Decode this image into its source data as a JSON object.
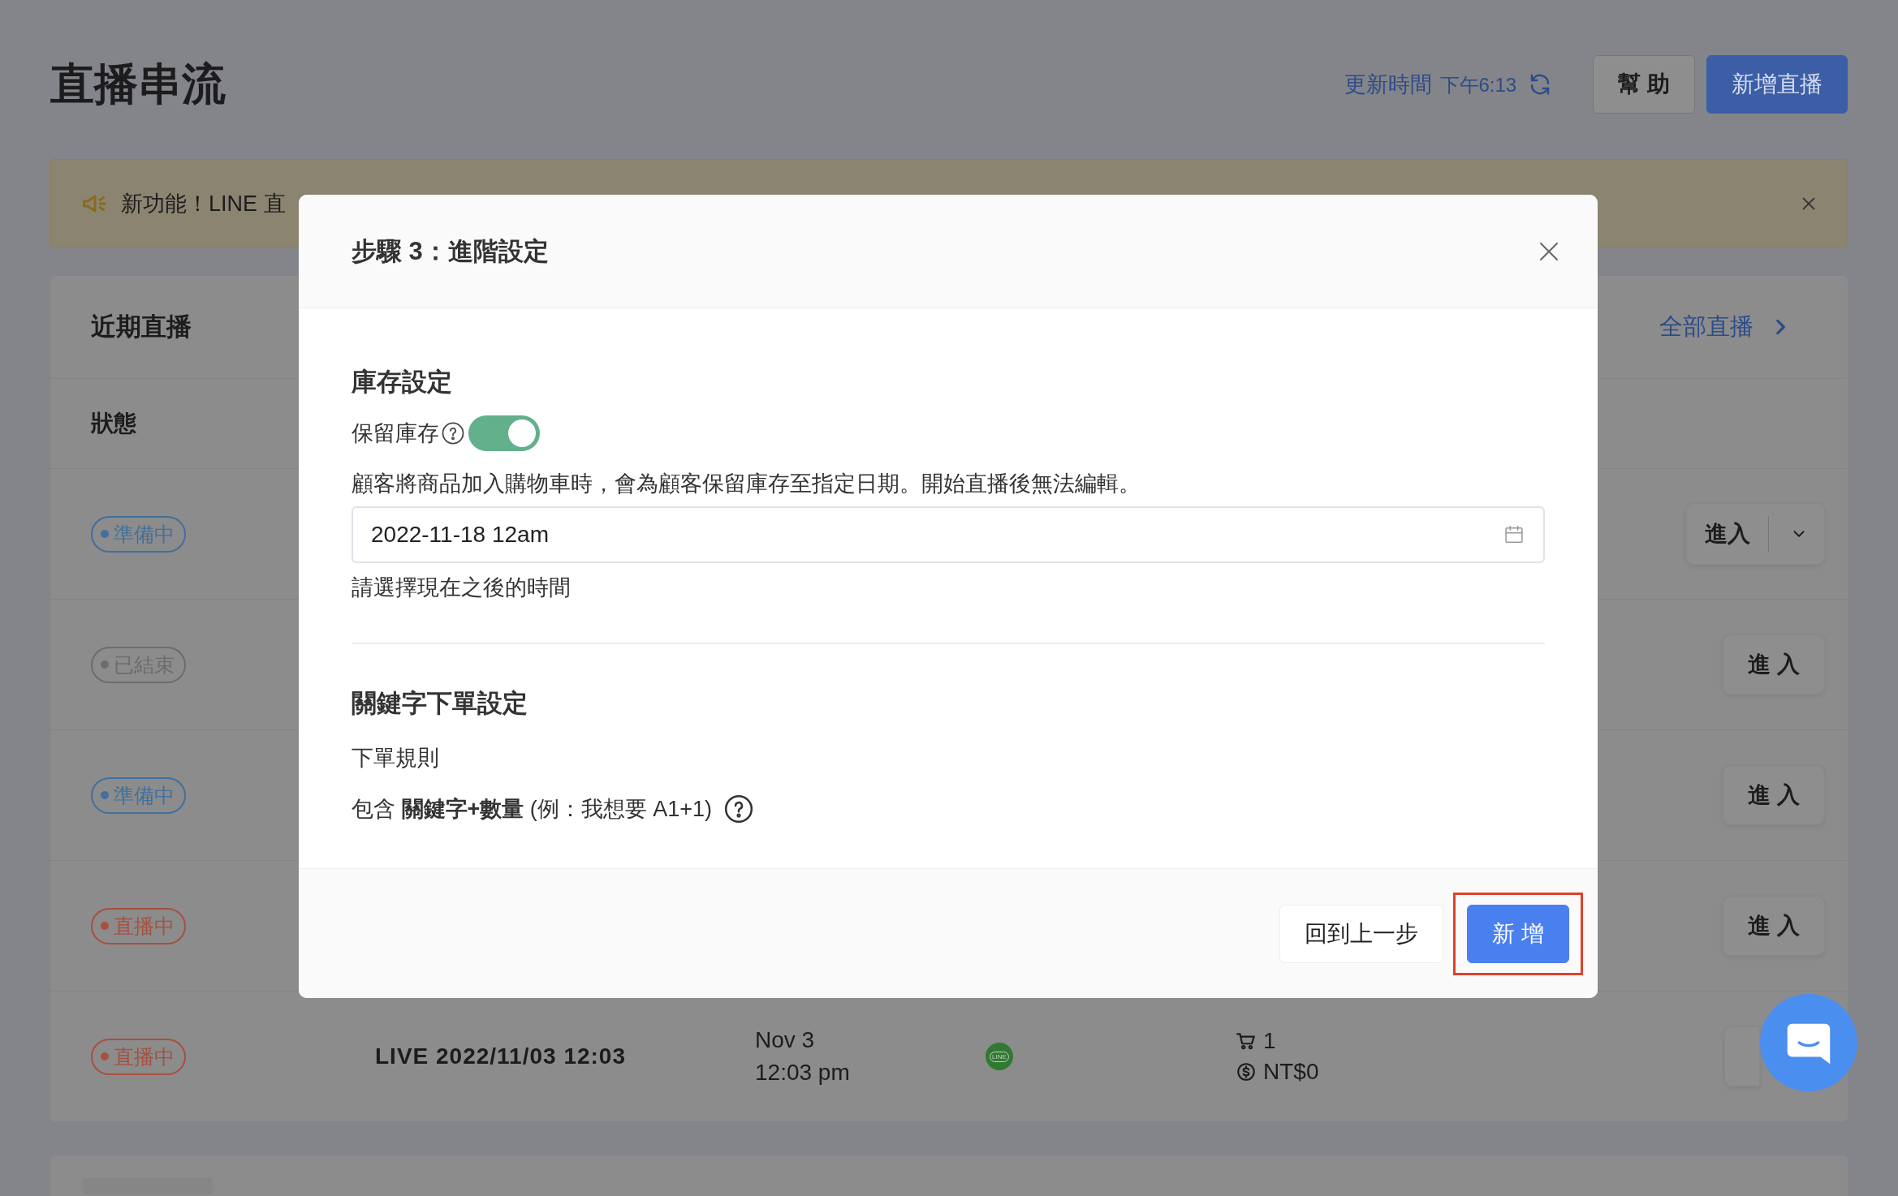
{
  "page": {
    "title": "直播串流",
    "updated_label": "更新時間",
    "updated_time": "下午6:13",
    "buttons": [
      {
        "label": "幫 助",
        "kind": "default"
      },
      {
        "label": "新增直播",
        "kind": "primary"
      }
    ]
  },
  "banner": {
    "text": "新功能！LINE 直"
  },
  "card": {
    "title": "近期直播",
    "link": "全部直播",
    "column_1": "狀態",
    "rows": [
      {
        "status": "準備中",
        "color": "#41709c",
        "button": "進入",
        "kind": "split"
      },
      {
        "status": "已結束",
        "color": "#6c6c70",
        "button": "進 入",
        "kind": "plain"
      },
      {
        "status": "準備中",
        "color": "#41709c",
        "button": "進 入",
        "kind": "plain"
      },
      {
        "status": "直播中",
        "color": "#a8503f",
        "button": "進 入",
        "kind": "plain"
      },
      {
        "status": "直播中",
        "color": "#a8503f",
        "kind": "plain",
        "title": "LIVE 2022/11/03 12:03",
        "date": "Nov 3",
        "time": "12:03 pm",
        "channel": "LINE",
        "cart": "1",
        "amount": "NT$0"
      }
    ]
  },
  "modal": {
    "title": "步驟 3：進階設定",
    "stock": {
      "heading": "庫存設定",
      "label": "保留庫存",
      "on": true,
      "description": "顧客將商品加入購物車時，會為顧客保留庫存至指定日期。開始直播後無法編輯。",
      "date_value": "2022-11-18 12am",
      "hint": "請選擇現在之後的時間"
    },
    "keyword": {
      "heading": "關鍵字下單設定",
      "label": "下單規則",
      "rule": "包含 **關鍵字+數量** (例：我想要 A1+1)"
    },
    "buttons": [
      {
        "label": "回到上一步",
        "kind": "default",
        "highlighted": false
      },
      {
        "label": "新 增",
        "kind": "primary",
        "highlighted": true
      }
    ]
  }
}
